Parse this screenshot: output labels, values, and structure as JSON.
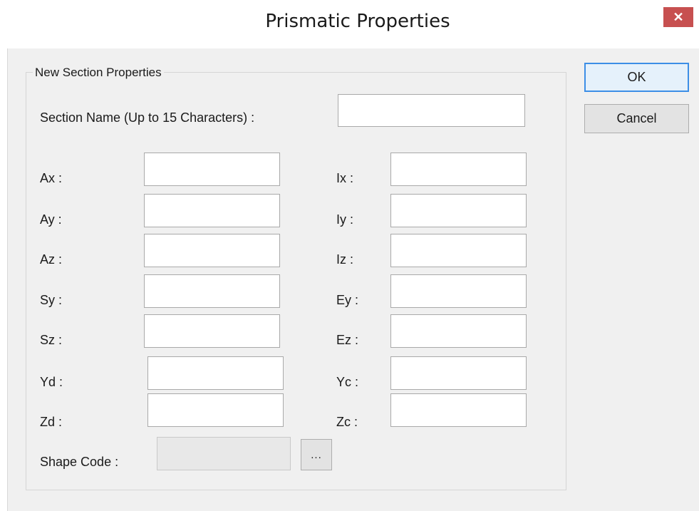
{
  "window": {
    "title": "Prismatic Properties",
    "close_glyph": "✕"
  },
  "group": {
    "legend": "New Section Properties"
  },
  "section_name": {
    "label": "Section Name (Up to 15 Characters) :",
    "value": ""
  },
  "fields_left": [
    {
      "label": "Ax :",
      "value": ""
    },
    {
      "label": "Ay :",
      "value": ""
    },
    {
      "label": "Az :",
      "value": ""
    },
    {
      "label": "Sy :",
      "value": ""
    },
    {
      "label": "Sz :",
      "value": ""
    },
    {
      "label": "Yd :",
      "value": ""
    },
    {
      "label": "Zd :",
      "value": ""
    }
  ],
  "fields_right": [
    {
      "label": "Ix :",
      "value": ""
    },
    {
      "label": "Iy :",
      "value": ""
    },
    {
      "label": "Iz :",
      "value": ""
    },
    {
      "label": "Ey :",
      "value": ""
    },
    {
      "label": "Ez :",
      "value": ""
    },
    {
      "label": "Yc :",
      "value": ""
    },
    {
      "label": "Zc :",
      "value": ""
    }
  ],
  "shape_code": {
    "label": "Shape Code :",
    "value": "",
    "browse_label": "..."
  },
  "buttons": {
    "ok": "OK",
    "cancel": "Cancel"
  },
  "colors": {
    "close_button": "#c75050",
    "default_button_border": "#3c8ee6",
    "dialog_background": "#f0f0f0"
  }
}
